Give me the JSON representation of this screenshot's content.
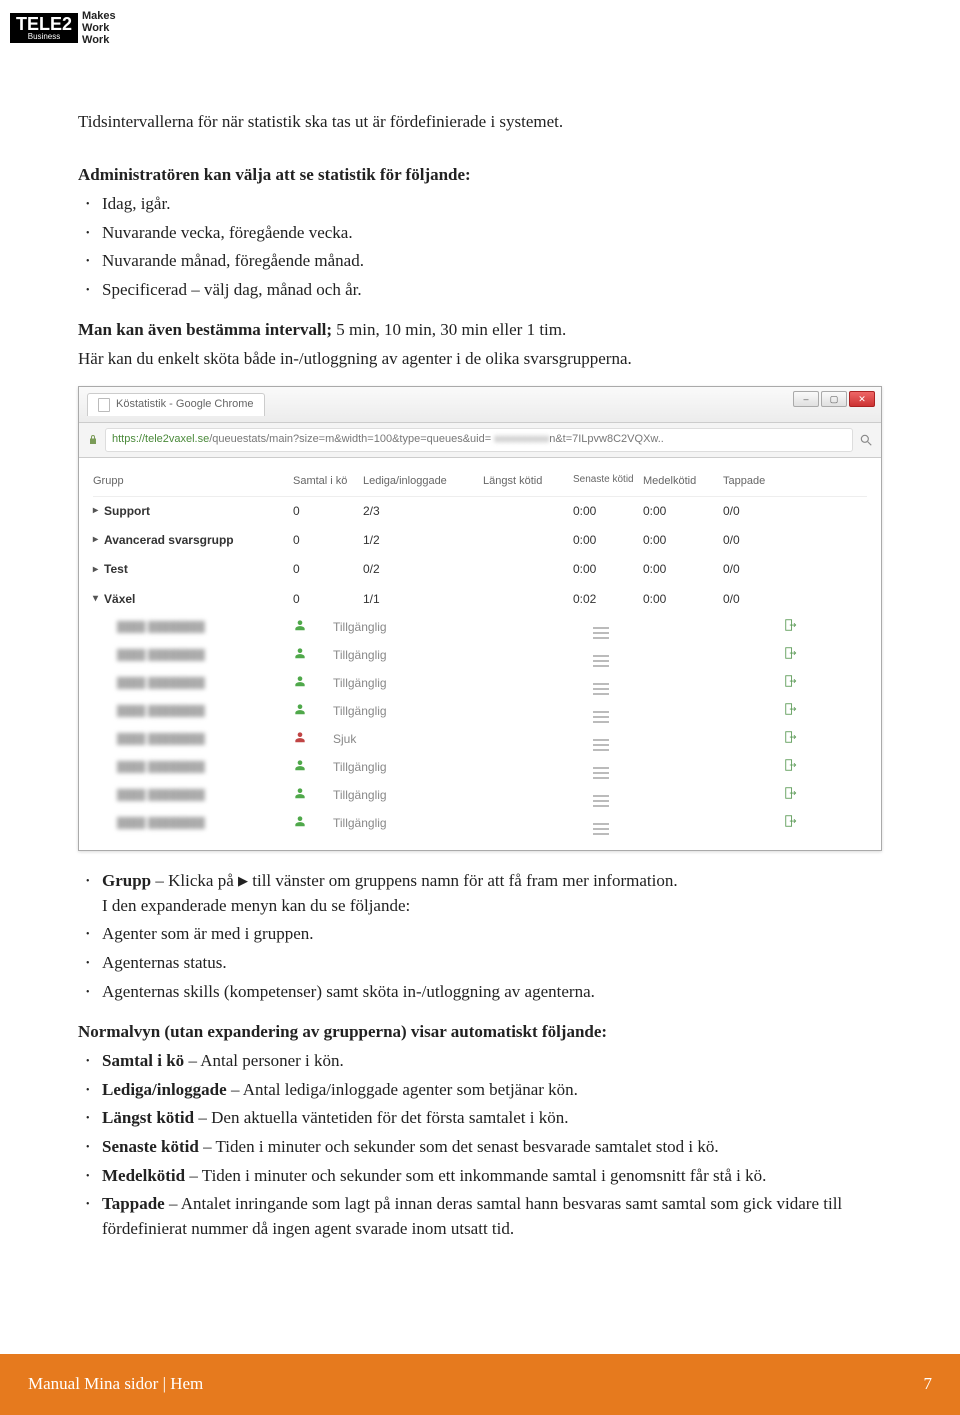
{
  "logo": {
    "tele2": "TELE2",
    "sub": "Business",
    "mww": [
      "Makes",
      "Work",
      "Work"
    ]
  },
  "intro": {
    "p1": "Tidsintervallerna för när statistik ska tas ut är fördefinierade i systemet.",
    "p2": "Administratören kan välja att se statistik för följande:",
    "bullets": [
      "Idag, igår.",
      "Nuvarande vecka, föregående vecka.",
      "Nuvarande månad, föregående månad.",
      "Specificerad – välj dag, månad och år."
    ],
    "p3_bold": "Man kan även bestämma intervall;",
    "p3_rest": "  5 min, 10 min, 30 min eller 1 tim.",
    "p4": "Här kan du enkelt sköta både in-/utloggning av agenter i de olika svarsgrupperna."
  },
  "ss": {
    "tabTitle": "Köstatistik - Google Chrome",
    "url_host": "https://tele2vaxel.se",
    "url_path": "/queuestats/main?size=m&width=100&type=queues&uid= ",
    "url_tail": "n&t=7ILpvw8C2VQXw..",
    "headers": [
      "Grupp",
      "Samtal i kö",
      "Lediga/inloggade",
      "Längst kötid",
      "Senaste kötid",
      "Medelkötid",
      "Tappade"
    ],
    "rows": [
      {
        "name": "Support",
        "tri": "▸",
        "c": [
          "0",
          "2/3",
          "",
          "0:00",
          "0:00",
          "0/0"
        ]
      },
      {
        "name": "Avancerad svarsgrupp",
        "tri": "▸",
        "c": [
          "0",
          "1/2",
          "",
          "0:00",
          "0:00",
          "0/0"
        ]
      },
      {
        "name": "Test",
        "tri": "▸",
        "c": [
          "0",
          "0/2",
          "",
          "0:00",
          "0:00",
          "0/0"
        ]
      },
      {
        "name": "Växel",
        "tri": "▾",
        "c": [
          "0",
          "1/1",
          "",
          "0:02",
          "0:00",
          "0/0"
        ]
      }
    ],
    "agents": [
      {
        "state": "green",
        "status": "Tillgänglig"
      },
      {
        "state": "green",
        "status": "Tillgänglig"
      },
      {
        "state": "green",
        "status": "Tillgänglig"
      },
      {
        "state": "green",
        "status": "Tillgänglig"
      },
      {
        "state": "red",
        "status": "Sjuk"
      },
      {
        "state": "green",
        "status": "Tillgänglig"
      },
      {
        "state": "green",
        "status": "Tillgänglig"
      },
      {
        "state": "green",
        "status": "Tillgänglig"
      }
    ]
  },
  "grupp": {
    "lead_bold": "Grupp",
    "lead_rest": " – Klicka på ",
    "lead_after": " till vänster om gruppens namn för att få fram mer information.",
    "sub": "I den expanderade menyn kan du se följande:",
    "bullets": [
      "Agenter som är med i gruppen.",
      "Agenternas status.",
      "Agenternas skills (kompetenser) samt sköta in-/utloggning av agenterna."
    ]
  },
  "normal": {
    "title": "Normalvyn (utan expandering av grupperna) visar automatiskt följande:",
    "items": [
      {
        "b": "Samtal i kö",
        "t": " – Antal personer i kön."
      },
      {
        "b": "Lediga/inloggade",
        "t": " – Antal lediga/inloggade agenter som betjänar kön."
      },
      {
        "b": "Längst kötid",
        "t": " – Den aktuella väntetiden för det första samtalet i kön."
      },
      {
        "b": "Senaste kötid",
        "t": " – Tiden i minuter och sekunder som det senast besvarade samtalet stod i kö."
      },
      {
        "b": "Medelkötid",
        "t": " – Tiden i minuter och sekunder som ett inkommande samtal i genomsnitt får stå i kö."
      },
      {
        "b": "Tappade",
        "t": " – Antalet inringande som lagt på innan deras samtal hann besvaras samt samtal som gick vidare till fördefinierat nummer då ingen agent svarade inom utsatt tid."
      }
    ]
  },
  "footer": {
    "left": "Manual Mina sidor | Hem",
    "right": "7"
  }
}
